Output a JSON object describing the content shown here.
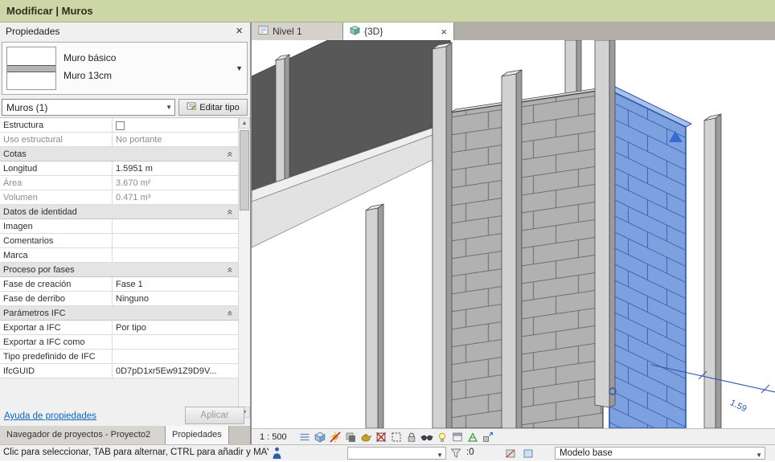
{
  "contextual_bar": {
    "title": "Modificar | Muros"
  },
  "colors": {
    "contextual_tab_green": "#ccd6a6",
    "selection_blue": "#2b57ac",
    "link_blue": "#0a66c2"
  },
  "glyphs": {
    "close_x": "×",
    "dropdown_arrow": "▼",
    "up_arrow": "▲",
    "down_arrow": "▼",
    "collapse_chevron": "«"
  },
  "properties_panel": {
    "header": "Propiedades",
    "type_selector": {
      "family": "Muro básico",
      "type": "Muro 13cm"
    },
    "selector": {
      "filter": "Muros (1)",
      "edit_type": "Editar tipo"
    },
    "rows": [
      {
        "kind": "row",
        "label": "Estructura",
        "value": "",
        "checkbox": true
      },
      {
        "kind": "row",
        "label": "Uso estructural",
        "value": "No portante",
        "readonly": true
      },
      {
        "kind": "section",
        "label": "Cotas"
      },
      {
        "kind": "row",
        "label": "Longitud",
        "value": "1.5951 m"
      },
      {
        "kind": "row",
        "label": "Área",
        "value": "3.670 m²",
        "readonly": true
      },
      {
        "kind": "row",
        "label": "Volumen",
        "value": "0.471 m³",
        "readonly": true
      },
      {
        "kind": "section",
        "label": "Datos de identidad"
      },
      {
        "kind": "row",
        "label": "Imagen",
        "value": ""
      },
      {
        "kind": "row",
        "label": "Comentarios",
        "value": ""
      },
      {
        "kind": "row",
        "label": "Marca",
        "value": ""
      },
      {
        "kind": "section",
        "label": "Proceso por fases"
      },
      {
        "kind": "row",
        "label": "Fase de creación",
        "value": "Fase 1"
      },
      {
        "kind": "row",
        "label": "Fase de derribo",
        "value": "Ninguno"
      },
      {
        "kind": "section",
        "label": "Parámetros IFC"
      },
      {
        "kind": "row",
        "label": "Exportar a IFC",
        "value": "Por tipo"
      },
      {
        "kind": "row",
        "label": "Exportar a IFC como",
        "value": ""
      },
      {
        "kind": "row",
        "label": "Tipo predefinido de IFC",
        "value": ""
      },
      {
        "kind": "row",
        "label": "IfcGUID",
        "value": "0D7pD1xr5Ew91Z9D9V..."
      }
    ],
    "footer": {
      "help_link": "Ayuda de propiedades",
      "apply": "Aplicar"
    },
    "tabs": [
      {
        "label": "Navegador de proyectos - Proyecto2",
        "active": false
      },
      {
        "label": "Propiedades",
        "active": true
      }
    ]
  },
  "view_tabs": [
    {
      "label": "Nivel 1",
      "icon": "plan-view-icon",
      "active": false
    },
    {
      "label": "{3D}",
      "icon": "3d-view-icon",
      "active": true,
      "closable": true
    }
  ],
  "view_controls": {
    "scale": "1 : 500",
    "icons": [
      "detail-level",
      "visual-style",
      "sun-path",
      "shadows",
      "rendering-dialog",
      "crop-view",
      "show-crop-region",
      "locked-3d-view",
      "temporary-hide-isolate",
      "reveal-hidden-elements",
      "temporary-view-properties",
      "analytical-model",
      "displacement-sets"
    ]
  },
  "viewport": {
    "dimension_label": "1.59",
    "selection_color": "#2b57ac"
  },
  "status_bar": {
    "message": "Clic para seleccionar, TAB para alternar, CTRL para añadir y MAY",
    "selection_count": ":0",
    "design_option": "Modelo base"
  }
}
